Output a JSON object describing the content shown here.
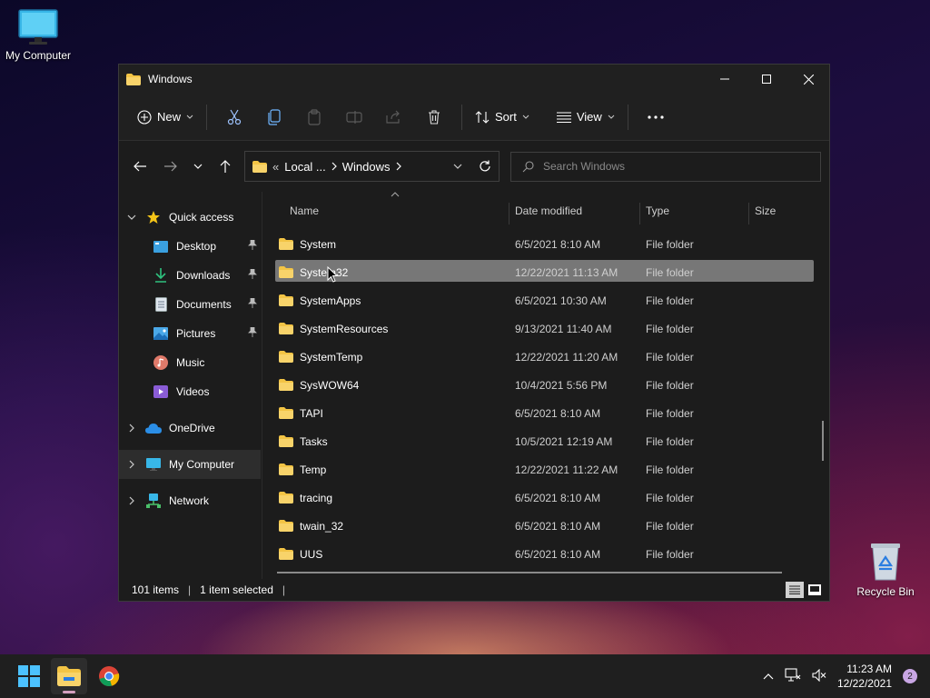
{
  "desktop": {
    "my_computer_label": "My Computer",
    "recycle_bin_label": "Recycle Bin"
  },
  "window": {
    "title": "Windows",
    "toolbar": {
      "new_label": "New",
      "sort_label": "Sort",
      "view_label": "View"
    },
    "address": {
      "prefix": "«",
      "crumb_1": "Local ...",
      "crumb_2": "Windows"
    },
    "search_placeholder": "Search Windows",
    "sidebar": {
      "quick_access": "Quick access",
      "items": [
        {
          "label": "Desktop",
          "pinned": true
        },
        {
          "label": "Downloads",
          "pinned": true
        },
        {
          "label": "Documents",
          "pinned": true
        },
        {
          "label": "Pictures",
          "pinned": true
        },
        {
          "label": "Music",
          "pinned": false
        },
        {
          "label": "Videos",
          "pinned": false
        }
      ],
      "onedrive": "OneDrive",
      "my_computer": "My Computer",
      "network": "Network"
    },
    "columns": {
      "name": "Name",
      "date": "Date modified",
      "type": "Type",
      "size": "Size"
    },
    "files": [
      {
        "name": "System",
        "date": "6/5/2021 8:10 AM",
        "type": "File folder"
      },
      {
        "name": "System32",
        "date": "12/22/2021 11:13 AM",
        "type": "File folder",
        "selected": true
      },
      {
        "name": "SystemApps",
        "date": "6/5/2021 10:30 AM",
        "type": "File folder"
      },
      {
        "name": "SystemResources",
        "date": "9/13/2021 11:40 AM",
        "type": "File folder"
      },
      {
        "name": "SystemTemp",
        "date": "12/22/2021 11:20 AM",
        "type": "File folder"
      },
      {
        "name": "SysWOW64",
        "date": "10/4/2021 5:56 PM",
        "type": "File folder"
      },
      {
        "name": "TAPI",
        "date": "6/5/2021 8:10 AM",
        "type": "File folder"
      },
      {
        "name": "Tasks",
        "date": "10/5/2021 12:19 AM",
        "type": "File folder"
      },
      {
        "name": "Temp",
        "date": "12/22/2021 11:22 AM",
        "type": "File folder"
      },
      {
        "name": "tracing",
        "date": "6/5/2021 8:10 AM",
        "type": "File folder"
      },
      {
        "name": "twain_32",
        "date": "6/5/2021 8:10 AM",
        "type": "File folder"
      },
      {
        "name": "UUS",
        "date": "6/5/2021 8:10 AM",
        "type": "File folder"
      }
    ],
    "status": {
      "items": "101 items",
      "selected": "1 item selected"
    }
  },
  "taskbar": {
    "time": "11:23 AM",
    "date": "12/22/2021",
    "notification_count": "2"
  },
  "colors": {
    "folder": "#f3c445",
    "accent": "#4cc2ff",
    "selected_row": "#777777"
  }
}
